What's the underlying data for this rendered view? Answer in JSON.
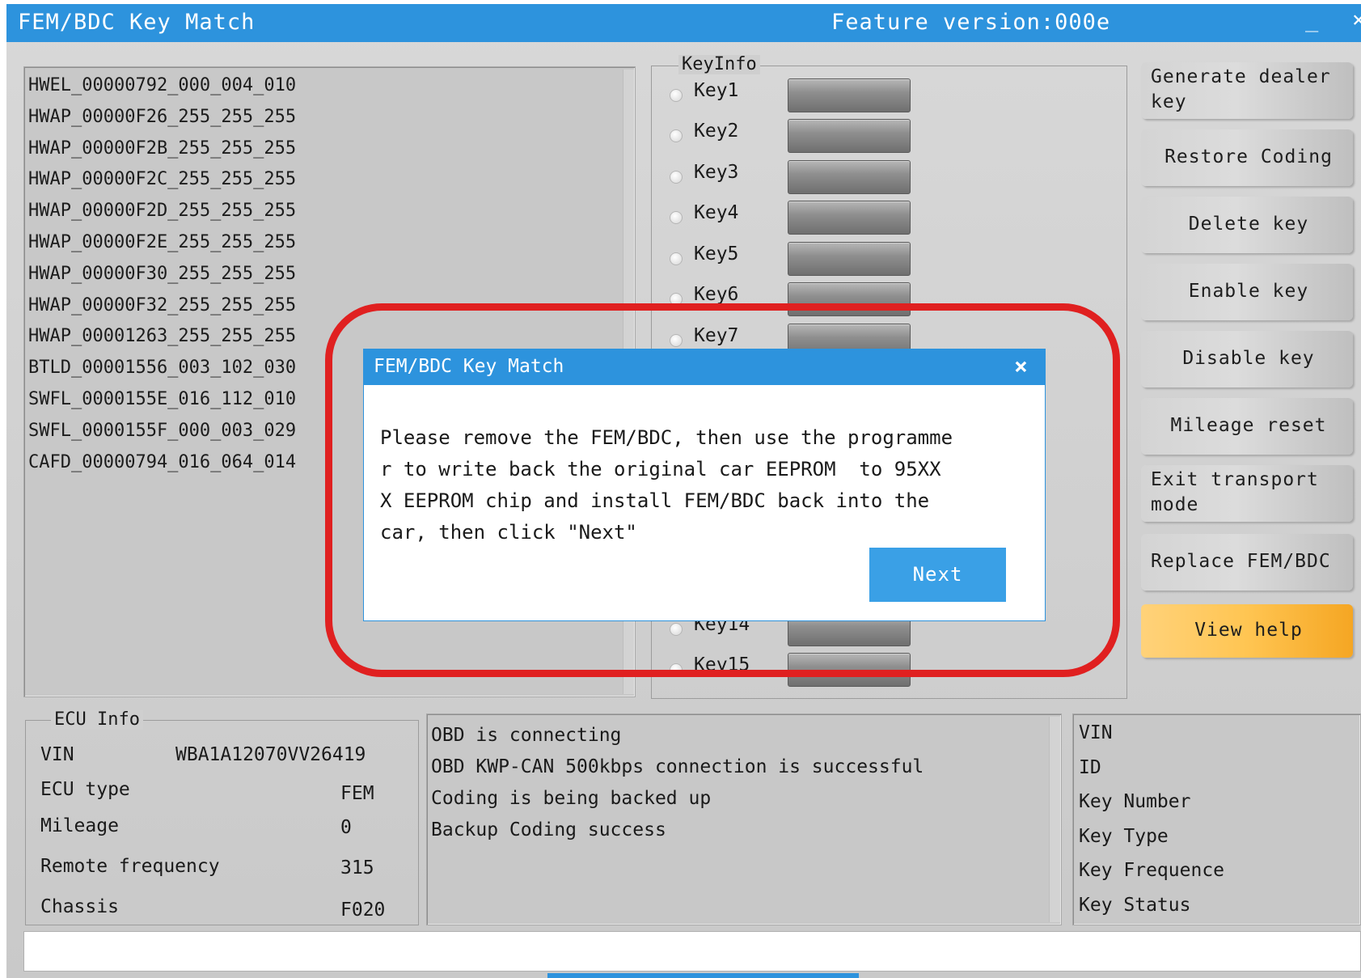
{
  "window": {
    "title": "FEM/BDC Key Match",
    "feature_version": "Feature version:000e",
    "minimize": "_",
    "close": "×"
  },
  "module_list": [
    "HWEL_00000792_000_004_010",
    "HWAP_00000F26_255_255_255",
    "HWAP_00000F2B_255_255_255",
    "HWAP_00000F2C_255_255_255",
    "HWAP_00000F2D_255_255_255",
    "HWAP_00000F2E_255_255_255",
    "HWAP_00000F30_255_255_255",
    "HWAP_00000F32_255_255_255",
    "HWAP_00001263_255_255_255",
    "BTLD_00001556_003_102_030",
    "SWFL_0000155E_016_112_010",
    "SWFL_0000155F_000_003_029",
    "CAFD_00000794_016_064_014"
  ],
  "key_info": {
    "legend": "KeyInfo",
    "keys": [
      "Key1",
      "Key2",
      "Key3",
      "Key4",
      "Key5",
      "Key6",
      "Key7",
      "Key14",
      "Key15"
    ]
  },
  "side_buttons": {
    "generate_dealer_key": "Generate dealer key",
    "restore_coding": "Restore Coding",
    "delete_key": "Delete key",
    "enable_key": "Enable key",
    "disable_key": "Disable key",
    "mileage_reset": "Mileage reset",
    "exit_transport": "Exit transport mode",
    "replace_fem": "Replace FEM/BDC",
    "view_help": "View help"
  },
  "ecu_info": {
    "legend": "ECU Info",
    "vin_label": "VIN",
    "vin_value": "WBA1A12070VV26419",
    "ecu_type_label": "ECU type",
    "ecu_type_value": "FEM",
    "mileage_label": "Mileage",
    "mileage_value": "0",
    "remote_freq_label": "Remote frequency",
    "remote_freq_value": "315",
    "chassis_label": "Chassis",
    "chassis_value": "F020"
  },
  "log": [
    "OBD is connecting",
    "OBD KWP-CAN 500kbps connection is successful",
    "Coding is being backed up",
    "Backup Coding success"
  ],
  "key_details": [
    "VIN",
    "ID",
    "Key Number",
    "Key Type",
    "Key Frequence",
    "Key Status"
  ],
  "dialog": {
    "title": "FEM/BDC Key Match",
    "close": "×",
    "message": "Please remove the FEM/BDC, then use the programme\nr to write back the original car EEPROM  to 95XX\nX EEPROM chip and install FEM/BDC back into the\ncar, then click \"Next\"",
    "next_label": "Next"
  },
  "colors": {
    "title_bar": "#2d93dd",
    "help_button": "#ffc552",
    "highlight_ring": "#e02020"
  }
}
